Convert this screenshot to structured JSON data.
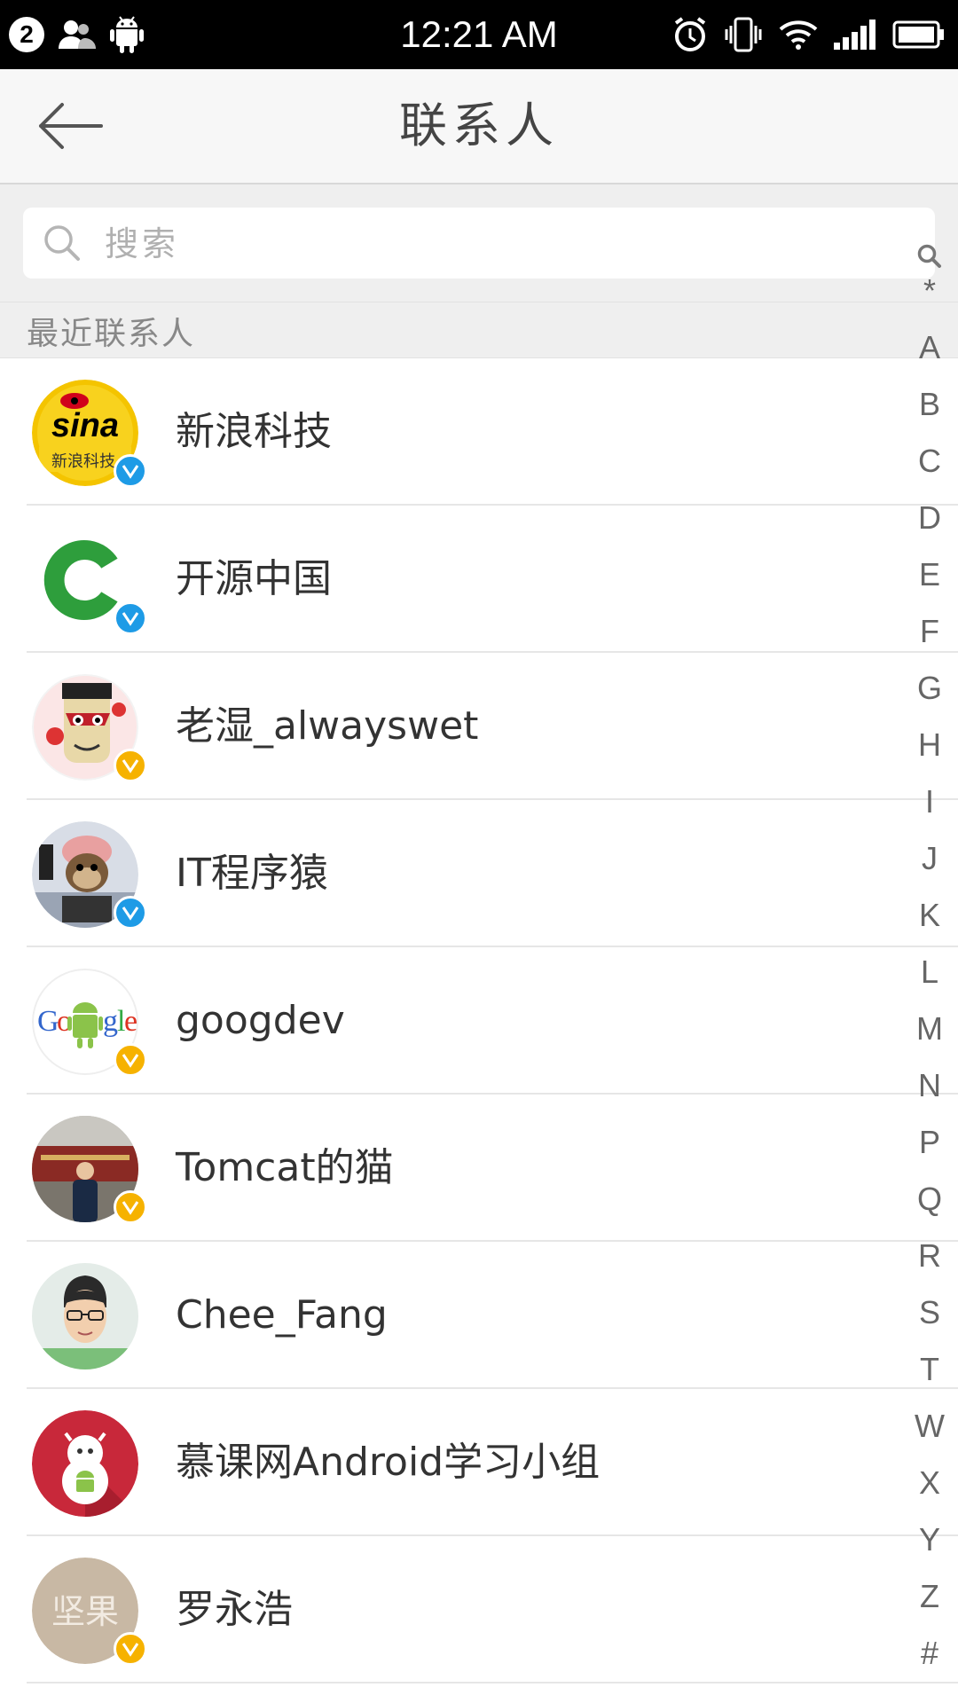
{
  "status_bar": {
    "notification_count": "2",
    "time": "12:21 AM",
    "icons_left": [
      "notification-count",
      "contacts-icon",
      "android-icon"
    ],
    "icons_right": [
      "alarm-icon",
      "vibrate-icon",
      "wifi-icon",
      "signal-icon",
      "battery-icon"
    ]
  },
  "header": {
    "title": "联系人",
    "back_icon": "arrow-left-icon"
  },
  "search": {
    "placeholder": "搜索",
    "icon": "search-icon"
  },
  "recent_section": {
    "label": "最近联系人"
  },
  "contacts": [
    {
      "name": "新浪科技",
      "verified": "blue",
      "avatar": "sina"
    },
    {
      "name": "开源中国",
      "verified": "blue",
      "avatar": "oschina"
    },
    {
      "name": "老湿_alwayswet",
      "verified": "yellow",
      "avatar": "cartoon"
    },
    {
      "name": "IT程序猿",
      "verified": "blue",
      "avatar": "monkey"
    },
    {
      "name": "googdev",
      "verified": "yellow",
      "avatar": "google"
    },
    {
      "name": "Tomcat的猫",
      "verified": "yellow",
      "avatar": "photo"
    },
    {
      "name": "Chee_Fang",
      "verified": "none",
      "avatar": "person"
    },
    {
      "name": "慕课网Android学习小组",
      "verified": "none",
      "avatar": "imooc"
    },
    {
      "name": "罗永浩",
      "verified": "yellow",
      "avatar": "smartisan",
      "avatar_text": "坚果"
    }
  ],
  "index_bar": [
    "*",
    "A",
    "B",
    "C",
    "D",
    "E",
    "F",
    "G",
    "H",
    "I",
    "J",
    "K",
    "L",
    "M",
    "N",
    "P",
    "Q",
    "R",
    "S",
    "T",
    "W",
    "X",
    "Y",
    "Z",
    "#"
  ],
  "colors": {
    "verified_blue": "#1e9be6",
    "verified_yellow": "#f6b200",
    "status_bar": "#000000",
    "action_bar": "#f7f7f7"
  }
}
